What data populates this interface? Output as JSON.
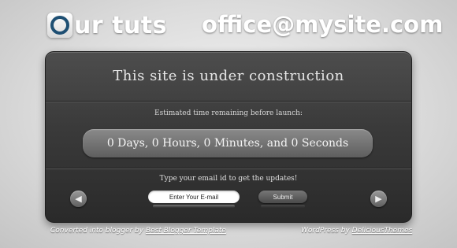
{
  "header": {
    "logo_text": "ur tuts",
    "email": "office@mysite.com"
  },
  "panel": {
    "headline": "This site is under construction",
    "estimate_label": "Estimated time remaining before launch:",
    "countdown": "0 Days, 0 Hours, 0 Minutes, and 0 Seconds",
    "subscribe_prompt": "Type your email id to get the updates!",
    "email_placeholder": "Enter Your E-mail",
    "submit_label": "Submit",
    "prev_arrow": "◀",
    "next_arrow": "▶"
  },
  "footer": {
    "left_prefix": "Converted into blogger by",
    "left_link": "Best Blogger Template",
    "right_prefix": "WordPress by",
    "right_link": "DeliciousThemes"
  },
  "colors": {
    "accent": "#1e4f73",
    "panel": "#3a3a3a",
    "background": "#dcdcdc"
  }
}
